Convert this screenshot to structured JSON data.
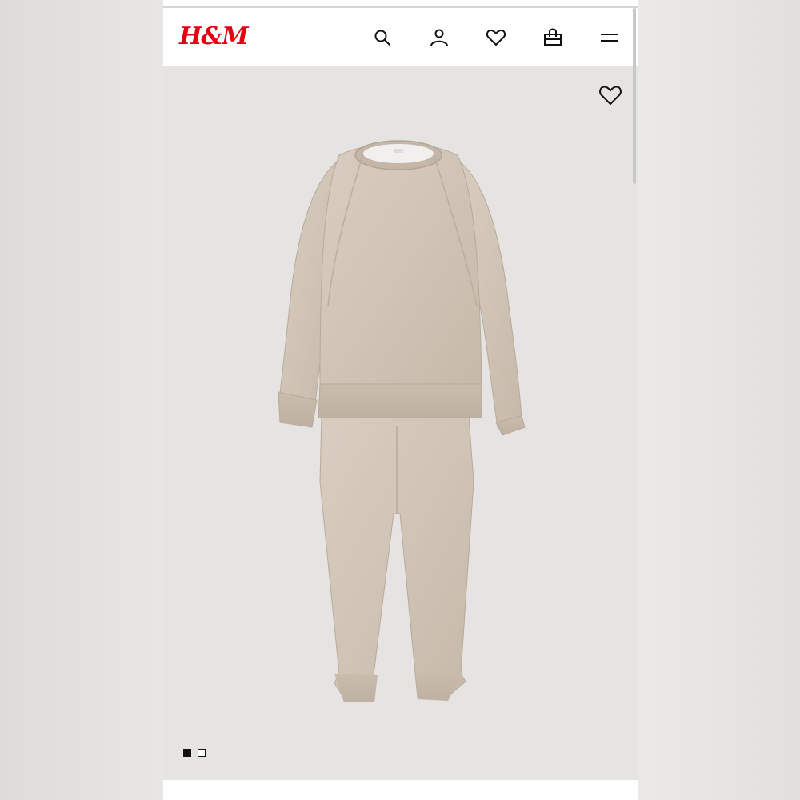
{
  "brand": {
    "logo_text": "H&M",
    "accent_color": "#e50010"
  },
  "header": {
    "icons": [
      "search-icon",
      "account-icon",
      "favorites-icon",
      "shopping-bag-icon",
      "menu-icon"
    ]
  },
  "product": {
    "image_description_icon": "product-image",
    "favorite_icon": "heart-icon",
    "carousel": {
      "total_images": 2,
      "active_index": 0
    }
  }
}
